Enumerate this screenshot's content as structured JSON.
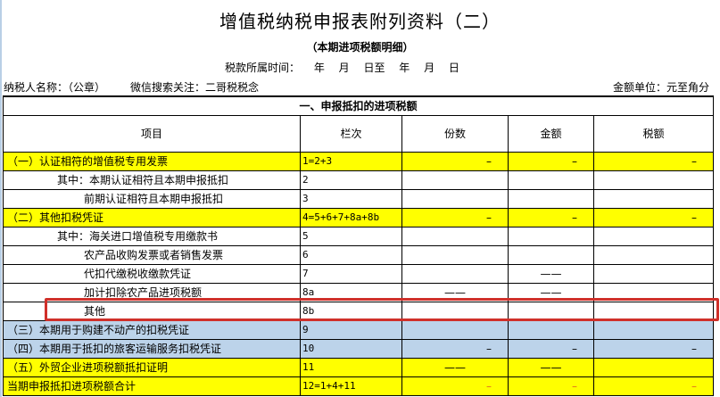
{
  "title": "增值税纳税申报表附列资料（二）",
  "subtitle": "（本期进项税额明细）",
  "period": "税款所属时间： 年 月 日至 年 月 日",
  "taxpayer": "纳税人名称：（公章）",
  "wechat": "微信搜索关注：二哥税税念",
  "unit": "金额单位：元至角分",
  "section": "一、申报抵扣的进项税额",
  "headers": [
    "项目",
    "栏次",
    "份数",
    "金额",
    "税额"
  ],
  "rows": [
    {
      "item": "（一）认证相符的增值税专用发票",
      "code": "1=2+3",
      "cells": [
        "–",
        "–",
        "–"
      ]
    },
    {
      "item": "其中：本期认证相符且本期申报抵扣",
      "code": "2",
      "cells": [
        "",
        "",
        ""
      ]
    },
    {
      "item": "前期认证相符且本期申报抵扣",
      "code": "3",
      "cells": [
        "",
        "",
        ""
      ]
    },
    {
      "item": "（二）其他扣税凭证",
      "code": "4=5+6+7+8a+8b",
      "cells": [
        "–",
        "–",
        "–"
      ]
    },
    {
      "item": "其中：海关进口增值税专用缴款书",
      "code": "5",
      "cells": [
        "",
        "",
        ""
      ]
    },
    {
      "item": "农产品收购发票或者销售发票",
      "code": "6",
      "cells": [
        "",
        "",
        ""
      ]
    },
    {
      "item": "代扣代缴税收缴款凭证",
      "code": "7",
      "cells": [
        "",
        "——",
        ""
      ]
    },
    {
      "item": "加计扣除农产品进项税额",
      "code": "8a",
      "cells": [
        "——",
        "——",
        ""
      ]
    },
    {
      "item": "其他",
      "code": "8b",
      "cells": [
        "",
        "",
        ""
      ]
    },
    {
      "item": "（三）本期用于购建不动产的扣税凭证",
      "code": "9",
      "cells": [
        "",
        "",
        ""
      ]
    },
    {
      "item": "（四）本期用于抵扣的旅客运输服务扣税凭证",
      "code": "10",
      "cells": [
        "–",
        "–",
        "–"
      ]
    },
    {
      "item": "（五）外贸企业进项税额抵扣证明",
      "code": "11",
      "cells": [
        "——",
        "——",
        ""
      ]
    },
    {
      "item": "当期申报抵扣进项税额合计",
      "code": "12=1+4+11",
      "cells": [
        "–",
        "–",
        "–"
      ]
    }
  ]
}
